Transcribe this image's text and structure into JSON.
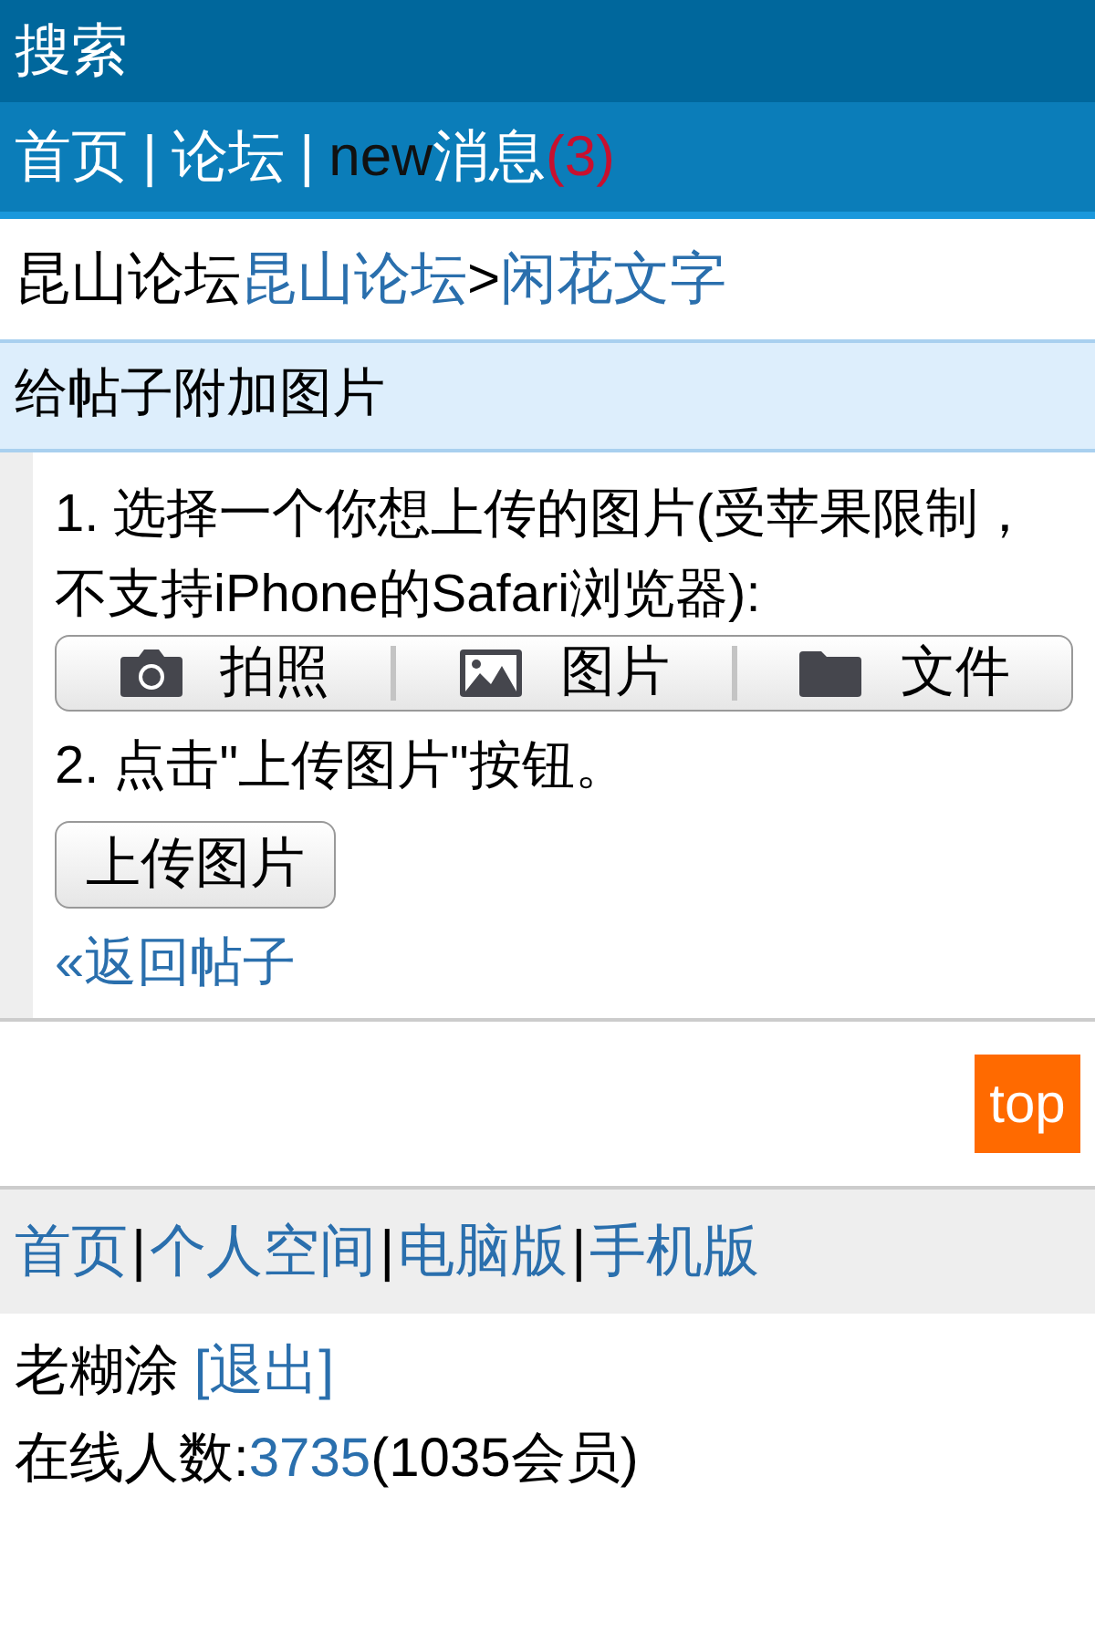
{
  "header": {
    "title": "搜索"
  },
  "nav": [
    {
      "kind": "link",
      "label": "首页"
    },
    {
      "kind": "sep",
      "label": "|"
    },
    {
      "kind": "link",
      "label": "论坛"
    },
    {
      "kind": "sep",
      "label": "|"
    },
    {
      "kind": "new",
      "label": "new"
    },
    {
      "kind": "link",
      "label": "消息"
    },
    {
      "kind": "count",
      "label": "(3)"
    }
  ],
  "breadcrumb": [
    {
      "kind": "text",
      "label": "昆山论坛"
    },
    {
      "kind": "link",
      "label": "昆山论坛"
    },
    {
      "kind": "text",
      "label": ">"
    },
    {
      "kind": "link",
      "label": "闲花文字"
    }
  ],
  "section": {
    "title": "给帖子附加图片",
    "step1": "1. 选择一个你想上传的图片(受苹果限制，不支持iPhone的Safari浏览器):",
    "picker": [
      {
        "kind": "camera",
        "label": "拍照"
      },
      {
        "kind": "photo",
        "label": "图片"
      },
      {
        "kind": "folder",
        "label": "文件"
      }
    ],
    "step2": "2. 点击\"上传图片\"按钮。",
    "upload_button": "上传图片",
    "back_link": "«返回帖子"
  },
  "top_button": "top",
  "footer_nav": [
    {
      "kind": "link",
      "label": "首页"
    },
    {
      "kind": "sep",
      "label": "|"
    },
    {
      "kind": "link",
      "label": "个人空间"
    },
    {
      "kind": "sep",
      "label": "|"
    },
    {
      "kind": "link",
      "label": "电脑版"
    },
    {
      "kind": "sep",
      "label": "|"
    },
    {
      "kind": "link",
      "label": "手机版"
    }
  ],
  "user": {
    "name": "老糊涂",
    "logout": "[退出]",
    "online_label": "在线人数:",
    "online_count": "3735",
    "members": "(1035会员)"
  }
}
